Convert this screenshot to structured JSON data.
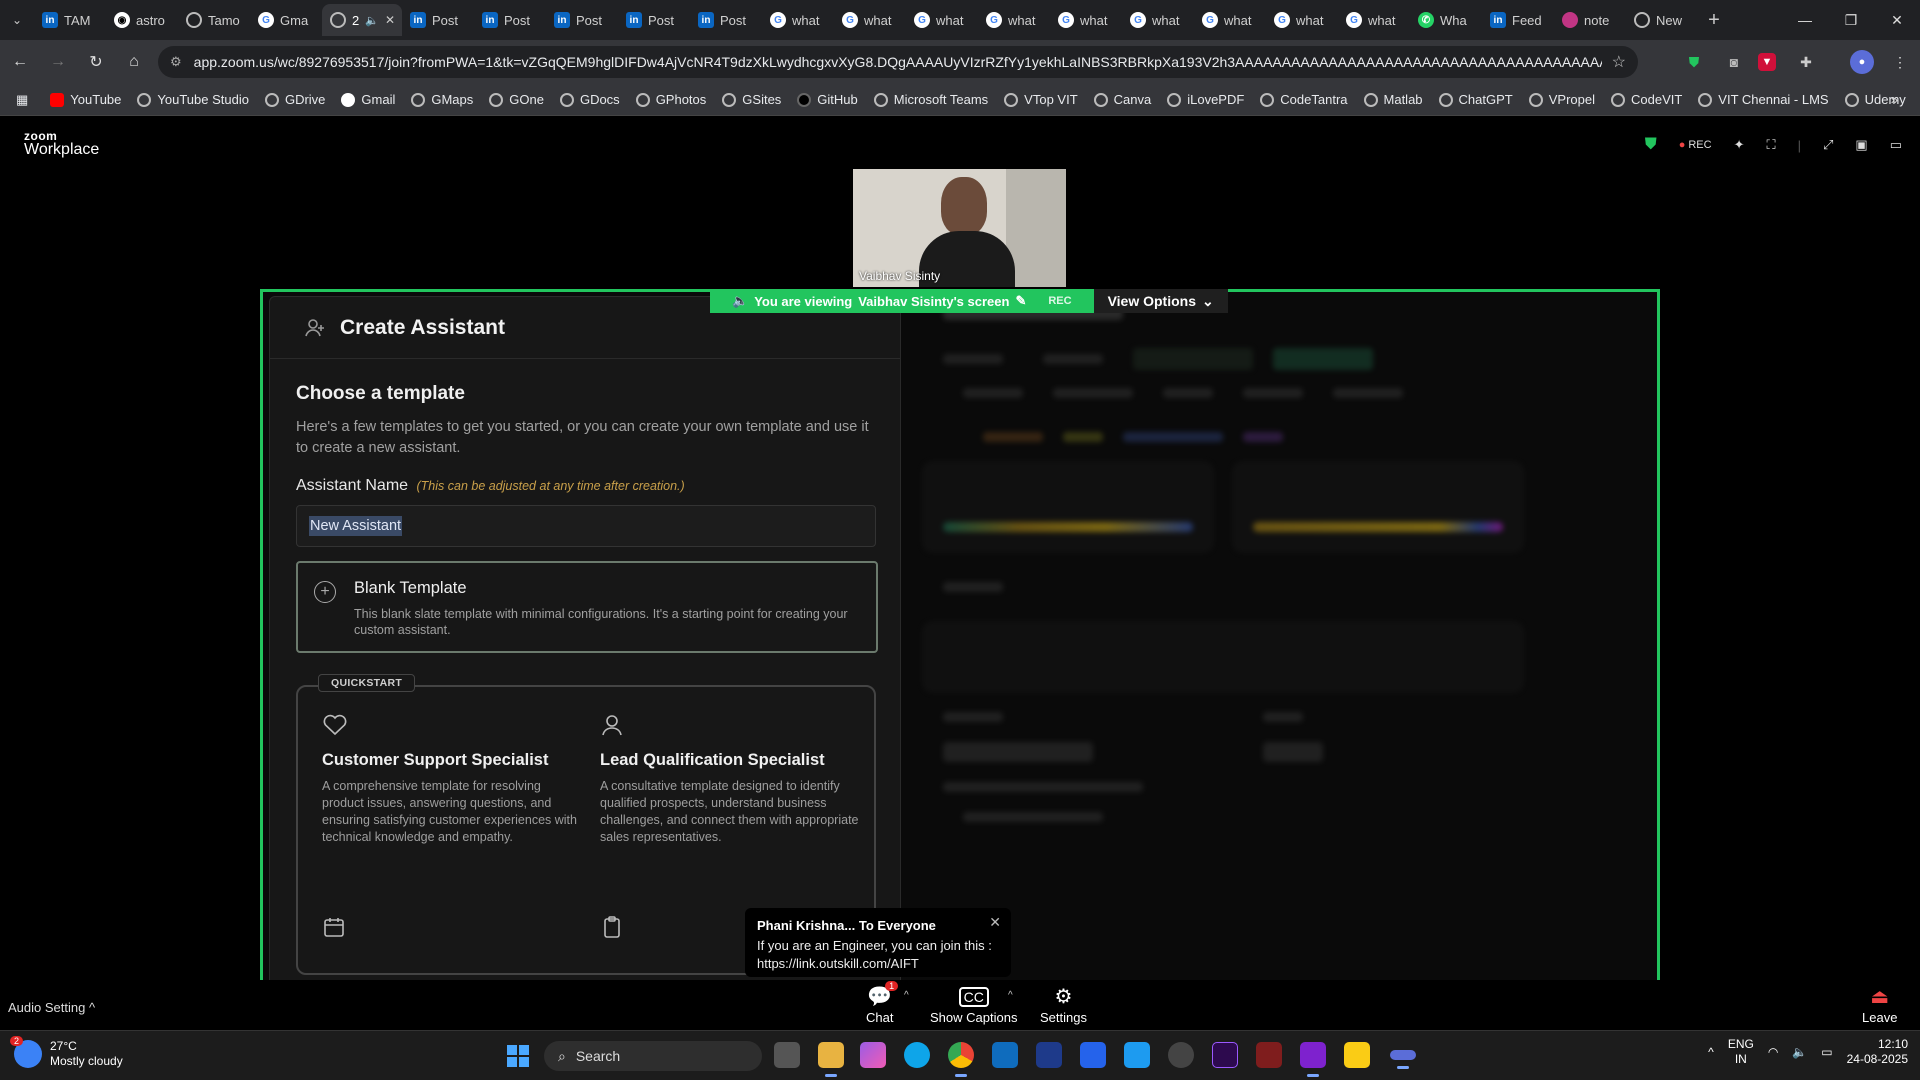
{
  "browser": {
    "tabs": [
      {
        "label": "TAM",
        "icon": "linkedin-icon"
      },
      {
        "label": "astro",
        "icon": "github-icon"
      },
      {
        "label": "Tamo",
        "icon": "globe-icon"
      },
      {
        "label": "Gma",
        "icon": "google-icon"
      },
      {
        "label": "2",
        "icon": "speaker-icon",
        "active": true
      },
      {
        "label": "Post",
        "icon": "linkedin-icon"
      },
      {
        "label": "Post",
        "icon": "linkedin-icon"
      },
      {
        "label": "Post",
        "icon": "linkedin-icon"
      },
      {
        "label": "Post",
        "icon": "linkedin-icon"
      },
      {
        "label": "Post",
        "icon": "linkedin-icon"
      },
      {
        "label": "what",
        "icon": "google-icon"
      },
      {
        "label": "what",
        "icon": "google-icon"
      },
      {
        "label": "what",
        "icon": "google-icon"
      },
      {
        "label": "what",
        "icon": "google-icon"
      },
      {
        "label": "what",
        "icon": "google-icon"
      },
      {
        "label": "what",
        "icon": "google-icon"
      },
      {
        "label": "what",
        "icon": "google-icon"
      },
      {
        "label": "what",
        "icon": "google-icon"
      },
      {
        "label": "what",
        "icon": "google-icon"
      },
      {
        "label": "Wha",
        "icon": "whatsapp-icon"
      },
      {
        "label": "Feed",
        "icon": "linkedin-icon"
      },
      {
        "label": "note",
        "icon": "note-icon"
      },
      {
        "label": "New",
        "icon": "globe-icon"
      }
    ],
    "url": "app.zoom.us/wc/89276953517/join?fromPWA=1&tk=vZGqQEM9hglDIFDw4AjVcNR4T9dzXkLwydhcgxvXyG8.DQgAAAAUyVIzrRZfYy1yekhLaINBS3RBRkpXa193V2h3AAAAAAAAAAAAAAAAAAAAAAAAAAAAAAAAAAAAAAAAAAA&_x_zm_r...",
    "bookmarks": [
      "YouTube",
      "YouTube Studio",
      "GDrive",
      "Gmail",
      "GMaps",
      "GOne",
      "GDocs",
      "GPhotos",
      "GSites",
      "GitHub",
      "Microsoft Teams",
      "VTop VIT",
      "Canva",
      "iLovePDF",
      "CodeTantra",
      "Matlab",
      "ChatGPT",
      "VPropel",
      "CodeVIT",
      "VIT Chennai - LMS",
      "Udemy"
    ]
  },
  "zoom": {
    "logo_top": "zoom",
    "logo_bottom": "Workplace",
    "rec": "REC",
    "participant_name": "Vaibhav Sisinty",
    "viewing_text": "You are viewing",
    "viewing_name": "Vaibhav Sisinty's screen",
    "viewing_rec": "REC",
    "view_options": "View Options",
    "chat": {
      "from": "Phani Krishna... To Everyone",
      "message": "If you are an Engineer, you can join this : https://link.outskill.com/AIFT"
    },
    "toolbar": {
      "audio": "Audio Setting",
      "chat": "Chat",
      "chat_badge": "1",
      "captions": "Show Captions",
      "settings": "Settings",
      "leave": "Leave"
    }
  },
  "modal": {
    "header": "Create Assistant",
    "title": "Choose a template",
    "description": "Here's a few templates to get you started, or you can create your own template and use it to create a new assistant.",
    "name_label": "Assistant Name",
    "name_hint": "(This can be adjusted at any time after creation.)",
    "name_value": "New Assistant",
    "blank_title": "Blank Template",
    "blank_desc": "This blank slate template with minimal configurations. It's a starting point for creating your custom assistant.",
    "quickstart_label": "QUICKSTART",
    "templates": [
      {
        "title": "Customer Support Specialist",
        "desc": "A comprehensive template for resolving product issues, answering questions, and ensuring satisfying customer experiences with technical knowledge and empathy."
      },
      {
        "title": "Lead Qualification Specialist",
        "desc": "A consultative template designed to identify qualified prospects, understand business challenges, and connect them with appropriate sales representatives."
      }
    ]
  },
  "taskbar": {
    "weather_badge": "2",
    "temperature": "27°C",
    "weather": "Mostly cloudy",
    "search": "Search",
    "lang_top": "ENG",
    "lang_bottom": "IN",
    "time": "12:10",
    "date": "24-08-2025"
  }
}
